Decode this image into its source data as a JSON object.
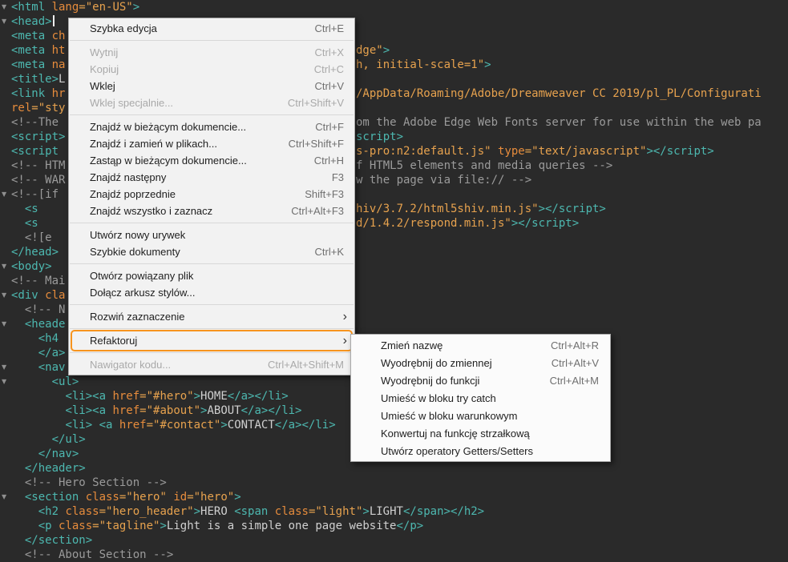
{
  "colors": {
    "editor_bg": "#2a2a2a",
    "code_tag": "#4db8b0",
    "code_attr": "#e78c3c",
    "code_string": "#e7a24e",
    "code_text": "#d0d0d0",
    "code_comment": "#9b9b9b",
    "menu_bg": "#f2f2f2",
    "submenu_bg": "#fbfbfb",
    "menu_text": "#1e1e1e",
    "menu_disabled": "#a9a9a9",
    "highlight_ring": "#f7941e",
    "caret": "#eeeeee"
  },
  "icons": {
    "fold_arrow": "▼",
    "submenu_arrow": "›"
  },
  "editor": {
    "lines": [
      {
        "fold": true,
        "segs": [
          [
            "tag",
            "<html "
          ],
          [
            "attr",
            "lang"
          ],
          [
            "str",
            "=\"en-US\""
          ],
          [
            "tag",
            ">"
          ]
        ]
      },
      {
        "fold": true,
        "caret": true,
        "segs": [
          [
            "tag",
            "<head>"
          ]
        ]
      },
      {
        "segs": [
          [
            "tag",
            "<meta "
          ],
          [
            "attr",
            "ch"
          ]
        ]
      },
      {
        "segs": [
          [
            "tag",
            "<meta "
          ],
          [
            "attr",
            "ht"
          ]
        ],
        "right": [
          [
            "str",
            "dge\""
          ],
          [
            "tag",
            ">"
          ]
        ]
      },
      {
        "segs": [
          [
            "tag",
            "<meta "
          ],
          [
            "attr",
            "na"
          ]
        ],
        "right": [
          [
            "str",
            "h, initial-scale=1\""
          ],
          [
            "tag",
            ">"
          ]
        ]
      },
      {
        "segs": [
          [
            "tag",
            "<title>"
          ],
          [
            "text",
            "L"
          ]
        ]
      },
      {
        "segs": [
          [
            "tag",
            "<link "
          ],
          [
            "attr",
            "hr"
          ]
        ],
        "right": [
          [
            "str",
            "/AppData/Roaming/Adobe/Dreamweaver CC 2019/pl_PL/Configurati"
          ]
        ]
      },
      {
        "segs": [
          [
            "attr",
            "rel"
          ],
          [
            "str",
            "=\"sty"
          ]
        ]
      },
      {
        "segs": [
          [
            "comment",
            "<!--The "
          ]
        ],
        "right": [
          [
            "comment",
            "om the Adobe Edge Web Fonts server for use within the web pa"
          ]
        ]
      },
      {
        "segs": [
          [
            "tag",
            "<script>"
          ]
        ],
        "right": [
          [
            "tag",
            "script>"
          ]
        ]
      },
      {
        "segs": [
          [
            "tag",
            "<script "
          ]
        ],
        "right": [
          [
            "str",
            "s-pro:n2:default.js\" "
          ],
          [
            "attr",
            "type"
          ],
          [
            "str",
            "=\"text/javascript\""
          ],
          [
            "tag",
            "></script>"
          ]
        ]
      },
      {
        "segs": [
          [
            "comment",
            "<!-- HTM"
          ]
        ],
        "right": [
          [
            "comment",
            "f HTML5 elements and media queries -->"
          ]
        ]
      },
      {
        "segs": [
          [
            "comment",
            "<!-- WAR"
          ]
        ],
        "right": [
          [
            "comment",
            "w the page via file:// -->"
          ]
        ]
      },
      {
        "fold": true,
        "segs": [
          [
            "comment",
            "<!--[if"
          ]
        ]
      },
      {
        "segs": [
          [
            "text",
            "  "
          ],
          [
            "tag",
            "<s"
          ]
        ],
        "right": [
          [
            "str",
            "hiv/3.7.2/html5shiv.min.js\""
          ],
          [
            "tag",
            "></script>"
          ]
        ]
      },
      {
        "segs": [
          [
            "text",
            "  "
          ],
          [
            "tag",
            "<s"
          ]
        ],
        "right": [
          [
            "str",
            "d/1.4.2/respond.min.js\""
          ],
          [
            "tag",
            "></script>"
          ]
        ]
      },
      {
        "segs": [
          [
            "comment",
            "  <![e"
          ]
        ]
      },
      {
        "segs": [
          [
            "tag",
            "</head>"
          ]
        ]
      },
      {
        "fold": true,
        "segs": [
          [
            "tag",
            "<body>"
          ]
        ]
      },
      {
        "segs": [
          [
            "comment",
            "<!-- Mai"
          ]
        ]
      },
      {
        "fold": true,
        "segs": [
          [
            "tag",
            "<div "
          ],
          [
            "attr",
            "cla"
          ]
        ]
      },
      {
        "segs": [
          [
            "comment",
            "  <!-- N"
          ]
        ]
      },
      {
        "fold": true,
        "segs": [
          [
            "text",
            "  "
          ],
          [
            "tag",
            "<heade"
          ]
        ]
      },
      {
        "segs": [
          [
            "text",
            "    "
          ],
          [
            "tag",
            "<h4 "
          ]
        ]
      },
      {
        "segs": [
          [
            "text",
            "    "
          ],
          [
            "tag",
            "</a>"
          ]
        ]
      },
      {
        "fold": true,
        "segs": [
          [
            "text",
            "    "
          ],
          [
            "tag",
            "<nav "
          ]
        ]
      },
      {
        "fold": true,
        "segs": [
          [
            "text",
            "      "
          ],
          [
            "tag",
            "<ul>"
          ]
        ]
      },
      {
        "segs": [
          [
            "text",
            "        "
          ],
          [
            "tag",
            "<li><a "
          ],
          [
            "attr",
            "href"
          ],
          [
            "str",
            "=\"#hero\""
          ],
          [
            "tag",
            ">"
          ],
          [
            "text",
            "HOME"
          ],
          [
            "tag",
            "</a></li>"
          ]
        ]
      },
      {
        "segs": [
          [
            "text",
            "        "
          ],
          [
            "tag",
            "<li><a "
          ],
          [
            "attr",
            "href"
          ],
          [
            "str",
            "=\"#about\""
          ],
          [
            "tag",
            ">"
          ],
          [
            "text",
            "ABOUT"
          ],
          [
            "tag",
            "</a></li>"
          ]
        ]
      },
      {
        "segs": [
          [
            "text",
            "        "
          ],
          [
            "tag",
            "<li>"
          ],
          [
            "text",
            " "
          ],
          [
            "tag",
            "<a "
          ],
          [
            "attr",
            "href"
          ],
          [
            "str",
            "=\"#contact\""
          ],
          [
            "tag",
            ">"
          ],
          [
            "text",
            "CONTACT"
          ],
          [
            "tag",
            "</a></li>"
          ]
        ]
      },
      {
        "segs": [
          [
            "text",
            "      "
          ],
          [
            "tag",
            "</ul>"
          ]
        ]
      },
      {
        "segs": [
          [
            "text",
            "    "
          ],
          [
            "tag",
            "</nav>"
          ]
        ]
      },
      {
        "segs": [
          [
            "text",
            "  "
          ],
          [
            "tag",
            "</header>"
          ]
        ]
      },
      {
        "segs": [
          [
            "comment",
            "  <!-- Hero Section -->"
          ]
        ]
      },
      {
        "fold": true,
        "segs": [
          [
            "text",
            "  "
          ],
          [
            "tag",
            "<section "
          ],
          [
            "attr",
            "class"
          ],
          [
            "str",
            "=\"hero\""
          ],
          [
            "text",
            " "
          ],
          [
            "attr",
            "id"
          ],
          [
            "str",
            "=\"hero\""
          ],
          [
            "tag",
            ">"
          ]
        ]
      },
      {
        "segs": [
          [
            "text",
            "    "
          ],
          [
            "tag",
            "<h2 "
          ],
          [
            "attr",
            "class"
          ],
          [
            "str",
            "=\"hero_header\""
          ],
          [
            "tag",
            ">"
          ],
          [
            "text",
            "HERO "
          ],
          [
            "tag",
            "<span "
          ],
          [
            "attr",
            "class"
          ],
          [
            "str",
            "=\"light\""
          ],
          [
            "tag",
            ">"
          ],
          [
            "text",
            "LIGHT"
          ],
          [
            "tag",
            "</span></h2>"
          ]
        ]
      },
      {
        "segs": [
          [
            "text",
            "    "
          ],
          [
            "tag",
            "<p "
          ],
          [
            "attr",
            "class"
          ],
          [
            "str",
            "=\"tagline\""
          ],
          [
            "tag",
            ">"
          ],
          [
            "text",
            "Light is a simple one page website"
          ],
          [
            "tag",
            "</p>"
          ]
        ]
      },
      {
        "segs": [
          [
            "text",
            "  "
          ],
          [
            "tag",
            "</section>"
          ]
        ]
      },
      {
        "segs": [
          [
            "comment",
            "  <!-- About Section -->"
          ]
        ]
      }
    ]
  },
  "context_menu": {
    "items": [
      {
        "type": "item",
        "label": "Szybka edycja",
        "shortcut": "Ctrl+E"
      },
      {
        "type": "separator"
      },
      {
        "type": "item",
        "label": "Wytnij",
        "shortcut": "Ctrl+X",
        "disabled": true
      },
      {
        "type": "item",
        "label": "Kopiuj",
        "shortcut": "Ctrl+C",
        "disabled": true
      },
      {
        "type": "item",
        "label": "Wklej",
        "shortcut": "Ctrl+V"
      },
      {
        "type": "item",
        "label": "Wklej specjalnie...",
        "shortcut": "Ctrl+Shift+V",
        "disabled": true
      },
      {
        "type": "separator"
      },
      {
        "type": "item",
        "label": "Znajdź w bieżącym dokumencie...",
        "shortcut": "Ctrl+F"
      },
      {
        "type": "item",
        "label": "Znajdź i zamień w plikach...",
        "shortcut": "Ctrl+Shift+F"
      },
      {
        "type": "item",
        "label": "Zastąp w bieżącym dokumencie...",
        "shortcut": "Ctrl+H"
      },
      {
        "type": "item",
        "label": "Znajdź następny",
        "shortcut": "F3"
      },
      {
        "type": "item",
        "label": "Znajdź poprzednie",
        "shortcut": "Shift+F3"
      },
      {
        "type": "item",
        "label": "Znajdź wszystko i zaznacz",
        "shortcut": "Ctrl+Alt+F3"
      },
      {
        "type": "separator"
      },
      {
        "type": "item",
        "label": "Utwórz nowy urywek"
      },
      {
        "type": "item",
        "label": "Szybkie dokumenty",
        "shortcut": "Ctrl+K"
      },
      {
        "type": "separator"
      },
      {
        "type": "item",
        "label": "Otwórz powiązany plik"
      },
      {
        "type": "item",
        "label": "Dołącz arkusz stylów..."
      },
      {
        "type": "separator"
      },
      {
        "type": "item",
        "label": "Rozwiń zaznaczenie",
        "submenu": true
      },
      {
        "type": "separator"
      },
      {
        "type": "item",
        "label": "Refaktoruj",
        "submenu": true,
        "highlighted": true
      },
      {
        "type": "separator"
      },
      {
        "type": "item",
        "label": "Nawigator kodu...",
        "shortcut": "Ctrl+Alt+Shift+M",
        "disabled": true
      }
    ]
  },
  "submenu": {
    "items": [
      {
        "label": "Zmień nazwę",
        "shortcut": "Ctrl+Alt+R"
      },
      {
        "label": "Wyodrębnij do zmiennej",
        "shortcut": "Ctrl+Alt+V"
      },
      {
        "label": "Wyodrębnij do funkcji",
        "shortcut": "Ctrl+Alt+M"
      },
      {
        "label": "Umieść w bloku try catch"
      },
      {
        "label": "Umieść w bloku warunkowym"
      },
      {
        "label": "Konwertuj na funkcję strzałkową"
      },
      {
        "label": "Utwórz operatory Getters/Setters"
      }
    ]
  }
}
